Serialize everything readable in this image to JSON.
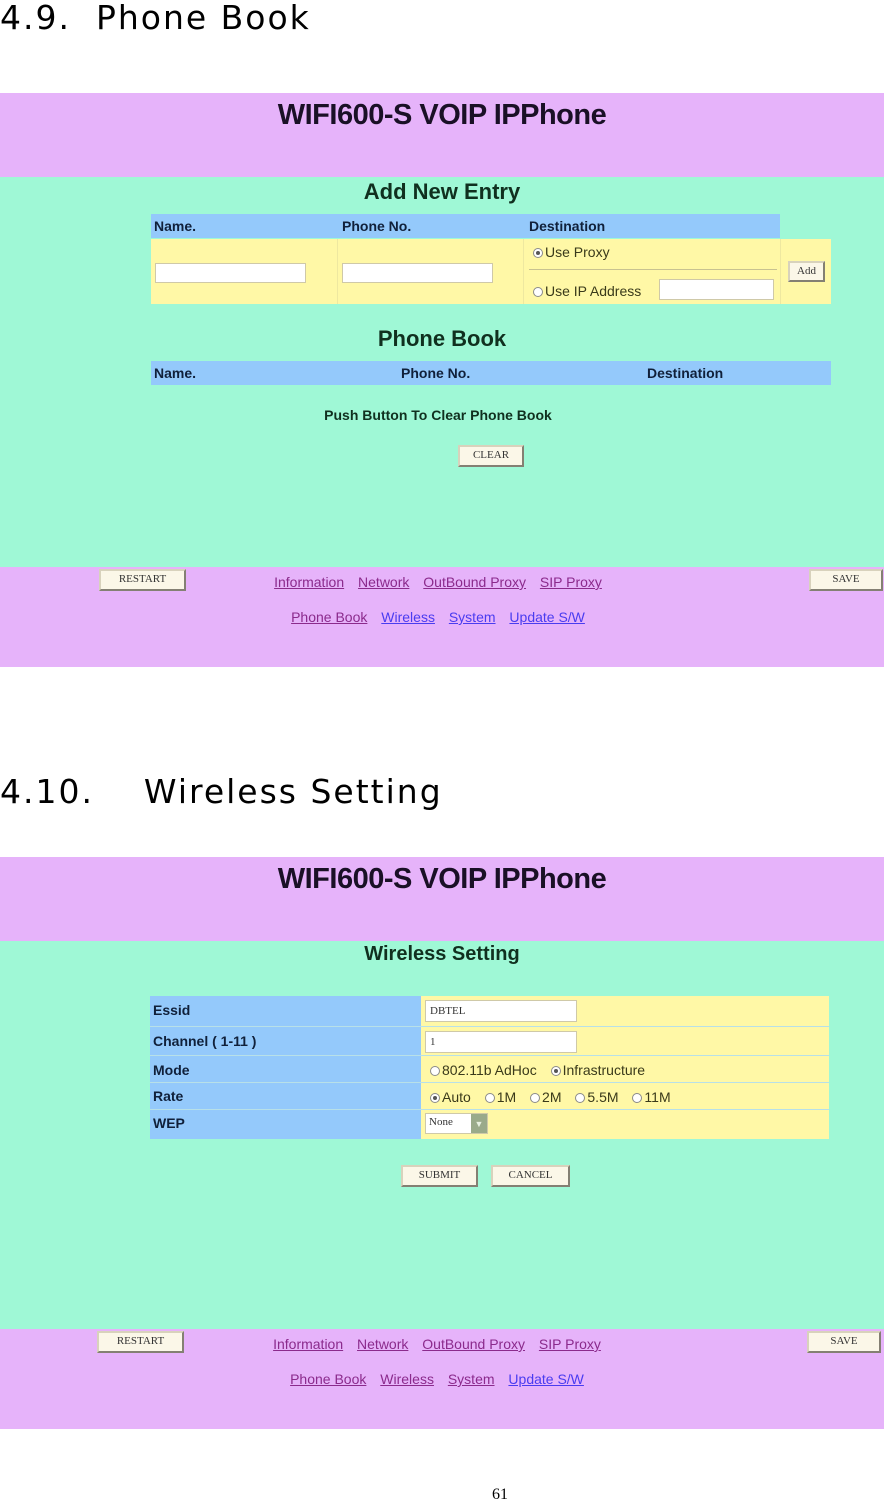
{
  "sections": [
    {
      "title": "4.9.  Phone Book"
    },
    {
      "title": "4.10.    Wireless Setting"
    }
  ],
  "phonebook_screen": {
    "header_title": "WIFI600-S VOIP IPPhone",
    "add_entry": {
      "title": "Add New Entry",
      "columns": [
        "Name.",
        "Phone No.",
        "Destination"
      ],
      "name_value": "",
      "phone_value": "",
      "destination_options": [
        {
          "label": "Use Proxy",
          "selected": true
        },
        {
          "label": "Use IP Address",
          "selected": false
        }
      ],
      "ip_address_value": "",
      "add_button": "Add"
    },
    "phone_book": {
      "title": "Phone Book",
      "columns": [
        "Name.",
        "Phone No.",
        "Destination"
      ],
      "entries": []
    },
    "clear_message": "Push Button To Clear Phone Book",
    "clear_button": "CLEAR",
    "footer": {
      "restart_button": "RESTART",
      "save_button": "SAVE",
      "links_row1": [
        {
          "label": "Information",
          "visited": true
        },
        {
          "label": "Network",
          "visited": true
        },
        {
          "label": "OutBound Proxy",
          "visited": true
        },
        {
          "label": "SIP Proxy",
          "visited": true
        }
      ],
      "links_row2": [
        {
          "label": "Phone Book",
          "visited": true
        },
        {
          "label": "Wireless",
          "visited": false
        },
        {
          "label": "System",
          "visited": false
        },
        {
          "label": "Update S/W",
          "visited": false
        }
      ]
    }
  },
  "wireless_screen": {
    "header_title": "WIFI600-S VOIP IPPhone",
    "title": "Wireless Setting",
    "fields": {
      "essid": {
        "label": "Essid",
        "value": "DBTEL"
      },
      "channel": {
        "label": "Channel ( 1-11 )",
        "value": "1"
      },
      "mode": {
        "label": "Mode",
        "options": [
          {
            "label": "802.11b AdHoc",
            "selected": false
          },
          {
            "label": "Infrastructure",
            "selected": true
          }
        ]
      },
      "rate": {
        "label": "Rate",
        "options": [
          {
            "label": "Auto",
            "selected": true
          },
          {
            "label": "1M",
            "selected": false
          },
          {
            "label": "2M",
            "selected": false
          },
          {
            "label": "5.5M",
            "selected": false
          },
          {
            "label": "11M",
            "selected": false
          }
        ]
      },
      "wep": {
        "label": "WEP",
        "value": "None"
      }
    },
    "submit_button": "SUBMIT",
    "cancel_button": "CANCEL",
    "footer": {
      "restart_button": "RESTART",
      "save_button": "SAVE",
      "links_row1": [
        {
          "label": "Information",
          "visited": true
        },
        {
          "label": "Network",
          "visited": true
        },
        {
          "label": "OutBound Proxy",
          "visited": true
        },
        {
          "label": "SIP Proxy",
          "visited": true
        }
      ],
      "links_row2": [
        {
          "label": "Phone Book",
          "visited": true
        },
        {
          "label": "Wireless",
          "visited": true
        },
        {
          "label": "System",
          "visited": true
        },
        {
          "label": "Update S/W",
          "visited": false
        }
      ]
    }
  },
  "page_number": "61"
}
